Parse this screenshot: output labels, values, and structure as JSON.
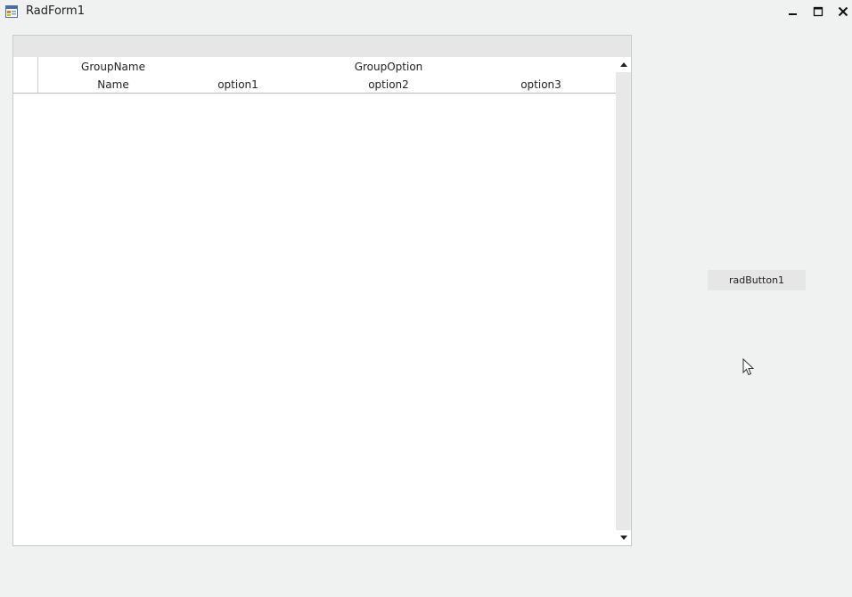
{
  "window": {
    "title": "RadForm1",
    "icon": "form-app-icon"
  },
  "grid": {
    "header_groups": {
      "group_name": "GroupName",
      "group_option": "GroupOption"
    },
    "columns": [
      "Name",
      "option1",
      "option2",
      "option3"
    ],
    "rows": []
  },
  "button": {
    "label": "radButton1"
  },
  "colors": {
    "background": "#f0f1f1",
    "group_panel": "#e6e6e6",
    "button": "#e6e6e6"
  }
}
